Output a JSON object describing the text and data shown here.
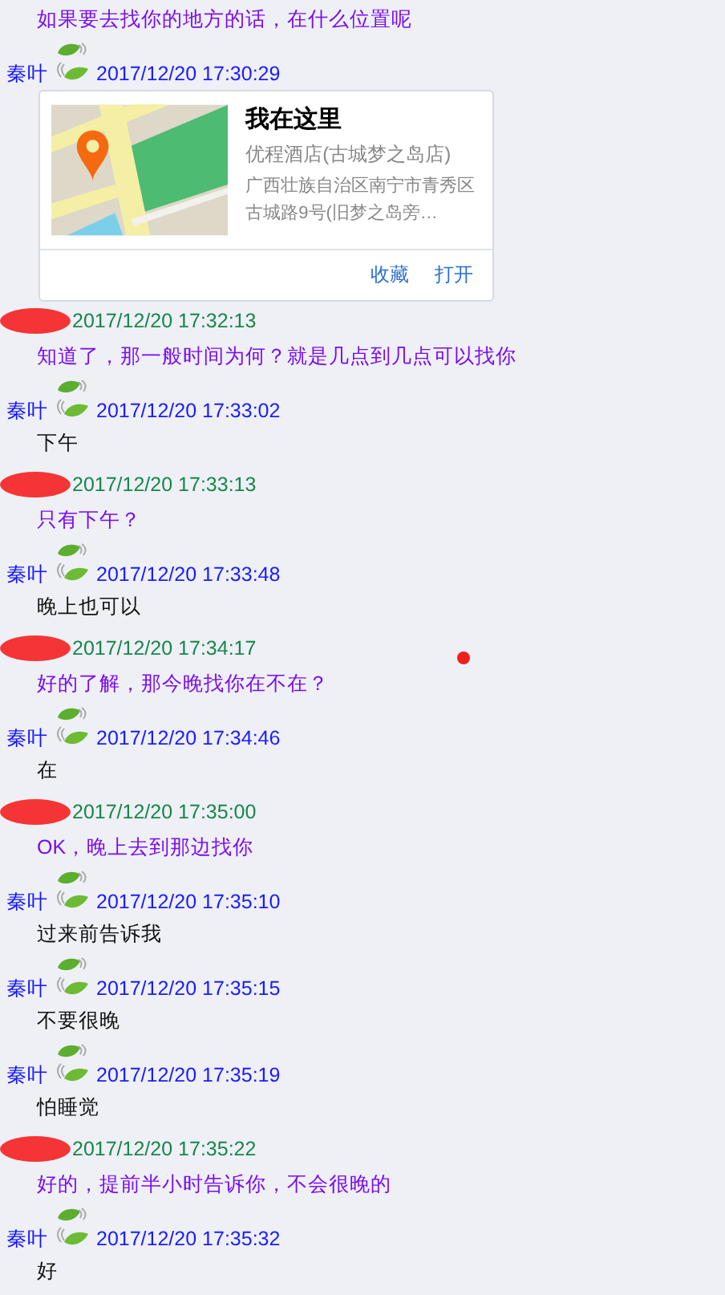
{
  "messages": [
    {
      "kind": "other",
      "text": "如果要去找你的地方的话，在什么位置呢"
    },
    {
      "kind": "self",
      "name": "秦叶",
      "time": "2017/12/20 17:30:29",
      "card": {
        "title": "我在这里",
        "place": "优程酒店(古城梦之岛店)",
        "address": "广西壮族自治区南宁市青秀区古城路9号(旧梦之岛旁…",
        "actions": [
          "收藏",
          "打开"
        ]
      }
    },
    {
      "kind": "other",
      "time": "2017/12/20 17:32:13",
      "text": "知道了，那一般时间为何？就是几点到几点可以找你"
    },
    {
      "kind": "self",
      "name": "秦叶",
      "time": "2017/12/20 17:33:02",
      "text": "下午"
    },
    {
      "kind": "other",
      "time": "2017/12/20 17:33:13",
      "text": "只有下午？"
    },
    {
      "kind": "self",
      "name": "秦叶",
      "time": "2017/12/20 17:33:48",
      "text": "晚上也可以"
    },
    {
      "kind": "other",
      "time": "2017/12/20 17:34:17",
      "text": "好的了解，那今晚找你在不在？"
    },
    {
      "kind": "self",
      "name": "秦叶",
      "time": "2017/12/20 17:34:46",
      "text": "在"
    },
    {
      "kind": "other",
      "time": "2017/12/20 17:35:00",
      "text": "OK，晚上去到那边找你"
    },
    {
      "kind": "self",
      "name": "秦叶",
      "time": "2017/12/20 17:35:10",
      "text": "过来前告诉我"
    },
    {
      "kind": "self",
      "name": "秦叶",
      "time": "2017/12/20 17:35:15",
      "text": "不要很晚"
    },
    {
      "kind": "self",
      "name": "秦叶",
      "time": "2017/12/20 17:35:19",
      "text": "怕睡觉"
    },
    {
      "kind": "other",
      "time": "2017/12/20 17:35:22",
      "text": "好的，提前半小时告诉你，不会很晚的"
    },
    {
      "kind": "self",
      "name": "秦叶",
      "time": "2017/12/20 17:35:32",
      "text": "好"
    }
  ]
}
